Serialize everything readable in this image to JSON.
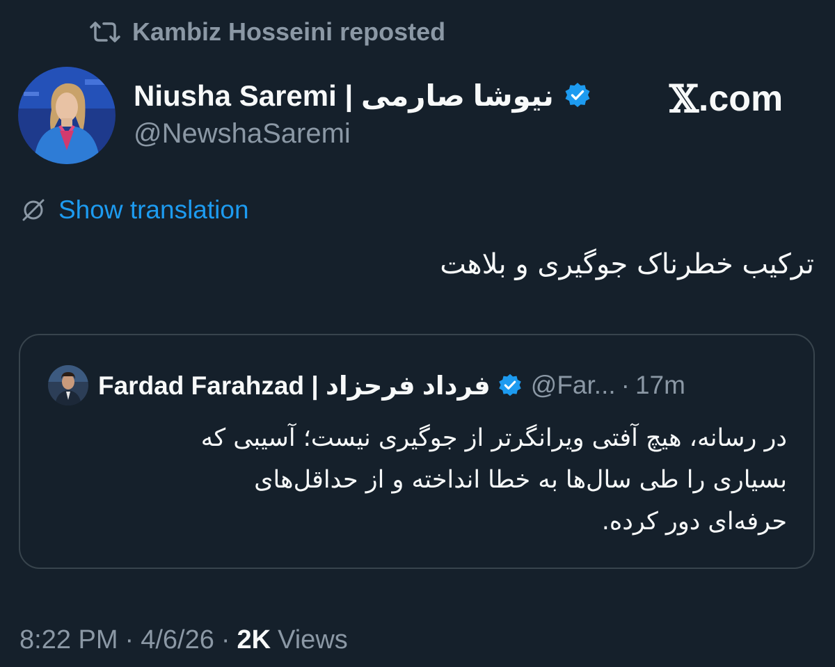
{
  "repost": {
    "icon": "repost-icon",
    "label": "Kambiz Hosseini reposted"
  },
  "author": {
    "avatar": "avatar-photo",
    "name": "Niusha Saremi | نیوشا صارمی",
    "verified_icon": "verified-badge-icon",
    "handle": "@NewshaSaremi"
  },
  "watermark": {
    "x_glyph": "𝕏",
    "domain": ".com"
  },
  "translation": {
    "icon": "globe-translate-icon",
    "label": "Show translation"
  },
  "tweet": {
    "text": "ترکیب خطرناک جوگیری و بلاهت"
  },
  "quote": {
    "avatar": "avatar-photo",
    "name": "Fardad Farahzad | فرداد فرحزاد",
    "verified_icon": "verified-badge-icon",
    "handle": "@Far...",
    "separator": "·",
    "time": "17m",
    "lines": [
      "در رسانه، هیچ آفتی ویرانگرتر از جوگیری نیست؛ آسیبی که",
      "بسیاری را طی سال‌ها به خطا انداخته و از حداقل‌های",
      "حرفه‌ای دور کرده."
    ]
  },
  "meta": {
    "time": "8:22 PM",
    "separator": "·",
    "date": "4/6/26",
    "views_count": "2K",
    "views_label": "Views"
  },
  "colors": {
    "background": "#15202b",
    "text_primary": "#f7f9f9",
    "text_secondary": "#8b98a5",
    "link": "#1d9bf0",
    "verified": "#1d9bf0",
    "border": "#38444d"
  }
}
